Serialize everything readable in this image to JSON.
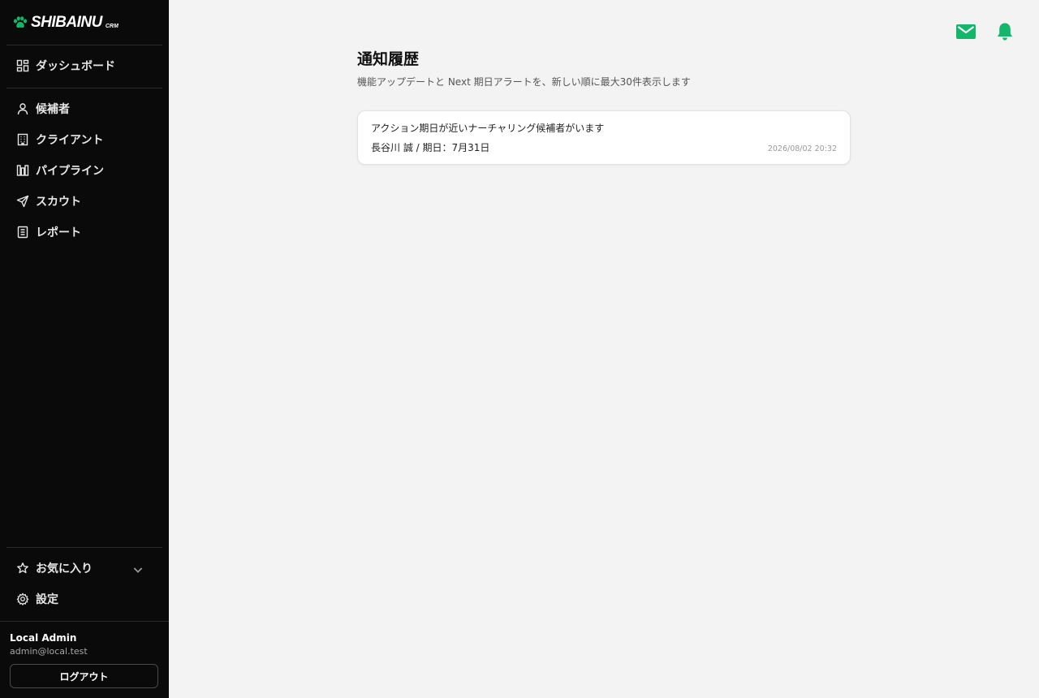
{
  "brand": {
    "name": "SHIBAINU",
    "sub": "CRM",
    "accent": "#12b76a"
  },
  "sidebar": {
    "dashboard": {
      "label": "ダッシュボード",
      "icon": "dashboard-icon"
    },
    "items": [
      {
        "label": "候補者",
        "icon": "user-icon"
      },
      {
        "label": "クライアント",
        "icon": "building-icon"
      },
      {
        "label": "パイプライン",
        "icon": "pipeline-icon"
      },
      {
        "label": "スカウト",
        "icon": "send-icon"
      },
      {
        "label": "レポート",
        "icon": "report-icon"
      }
    ],
    "favorites": {
      "label": "お気に入り",
      "icon": "star-icon"
    },
    "settings": {
      "label": "設定",
      "icon": "gear-icon"
    }
  },
  "user": {
    "name": "Local Admin",
    "email": "admin@local.test",
    "logout_label": "ログアウト"
  },
  "header": {
    "icons": [
      "mail-icon",
      "bell-icon"
    ]
  },
  "main": {
    "title": "通知履歴",
    "subtitle": "機能アップデートと Next 期日アラートを、新しい順に最大30件表示します",
    "notifications": [
      {
        "title": "アクション期日が近いナーチャリング候補者がいます",
        "detail": "長谷川 誠 / 期日：7月31日",
        "time": "2026/08/02 20:32"
      }
    ]
  }
}
